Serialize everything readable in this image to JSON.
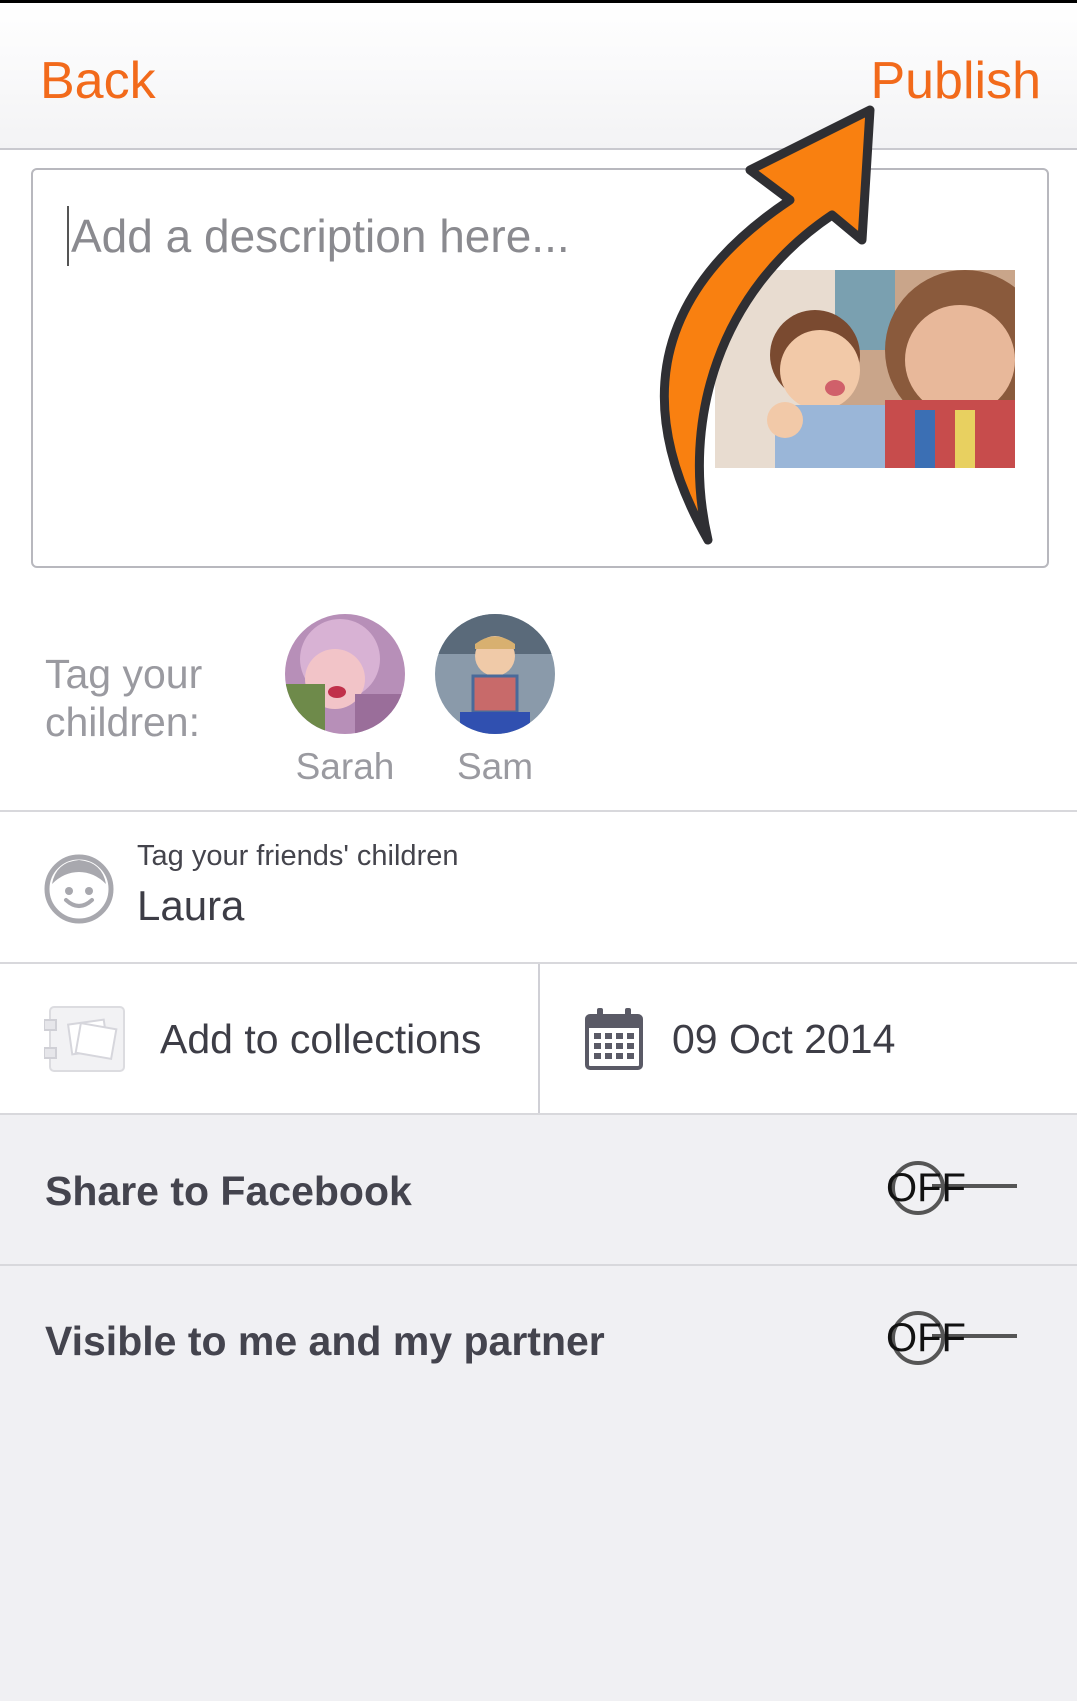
{
  "header": {
    "back_label": "Back",
    "publish_label": "Publish"
  },
  "description": {
    "placeholder": "Add a description here..."
  },
  "tag_children": {
    "label": "Tag your children:",
    "children": [
      {
        "name": "Sarah"
      },
      {
        "name": "Sam"
      }
    ]
  },
  "friends": {
    "caption": "Tag your friends' children",
    "value": "Laura"
  },
  "collections": {
    "label": "Add to collections"
  },
  "date": {
    "value": "09 Oct 2014"
  },
  "toggles": {
    "facebook": {
      "label": "Share to Facebook",
      "state": "OFF"
    },
    "visibility": {
      "label": "Visible to me and my partner",
      "state": "OFF"
    }
  },
  "colors": {
    "accent": "#f26a1b",
    "arrow": "#f98010"
  }
}
